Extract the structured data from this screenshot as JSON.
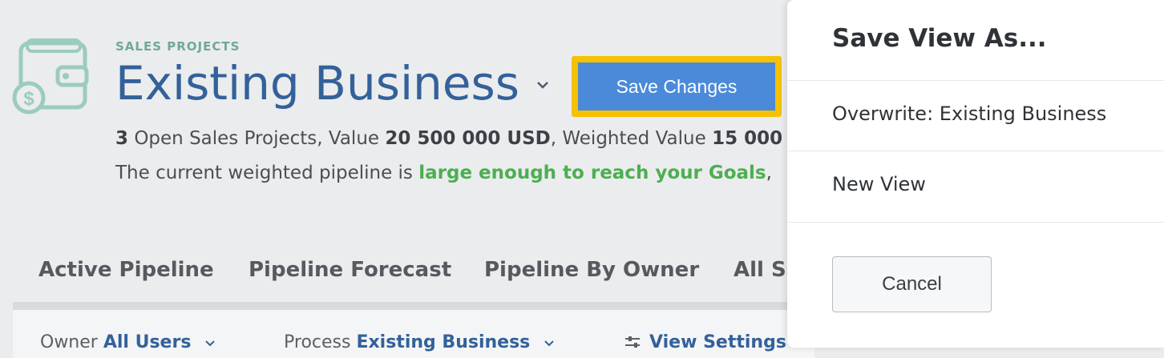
{
  "header": {
    "eyebrow": "SALES PROJECTS",
    "title": "Existing Business",
    "save_label": "Save Changes",
    "stats": {
      "count": "3",
      "count_label": " Open Sales Projects, Value ",
      "value": "20 500 000 USD",
      "weighted_label": ", Weighted Value ",
      "weighted_value": "15 000"
    },
    "pipeline": {
      "prefix": "The current weighted pipeline is ",
      "highlight": "large enough to reach your Goals",
      "suffix": ","
    }
  },
  "tabs": [
    {
      "label": "Active Pipeline"
    },
    {
      "label": "Pipeline Forecast"
    },
    {
      "label": "Pipeline By Owner"
    },
    {
      "label": "All Sa"
    }
  ],
  "filters": {
    "owner_label": "Owner ",
    "owner_value": "All Users",
    "process_label": "Process ",
    "process_value": "Existing Business",
    "view_settings": "View Settings"
  },
  "panel": {
    "title": "Save View As...",
    "overwrite": "Overwrite: Existing Business",
    "new_view": "New View",
    "cancel": "Cancel"
  },
  "colors": {
    "accent_blue": "#4a8ad9",
    "title_blue": "#33619a",
    "highlight_border": "#f5c100",
    "goal_green": "#4caf50",
    "eyebrow_teal": "#6fa89c"
  },
  "icons": [
    "wallet-dollar-icon",
    "chevron-down-icon",
    "sliders-icon"
  ]
}
